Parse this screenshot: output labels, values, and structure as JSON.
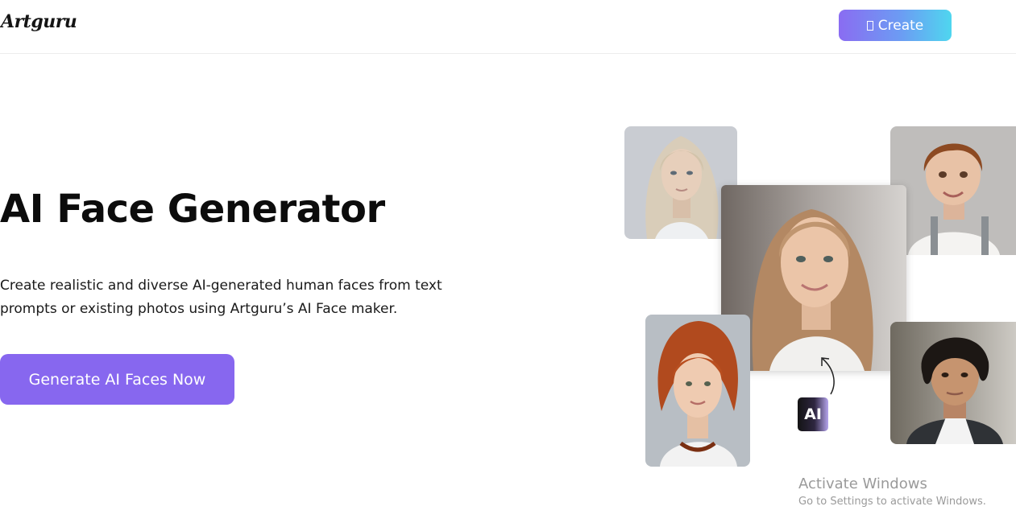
{
  "header": {
    "logo": "Artguru",
    "create_button": {
      "icon": "pencil-icon",
      "label": "Create"
    }
  },
  "hero": {
    "title": "AI Face Generator",
    "description": "Create realistic and diverse AI-generated human faces from text prompts or existing photos using Artguru’s AI Face maker.",
    "cta_label": "Generate AI Faces Now"
  },
  "collage": {
    "ai_badge": "AI",
    "photos": [
      "platinum-blonde-woman-portrait",
      "smiling-boy-portrait",
      "blonde-woman-portrait",
      "red-haired-woman-portrait",
      "curly-haired-man-portrait"
    ]
  },
  "watermark": {
    "title": "Activate Windows",
    "subtitle": "Go to Settings to activate Windows."
  },
  "colors": {
    "cta": "#8767ef",
    "create_gradient_start": "#8a6cf2",
    "create_gradient_end": "#4fd6ef",
    "watermark": "#9a9a9a"
  }
}
